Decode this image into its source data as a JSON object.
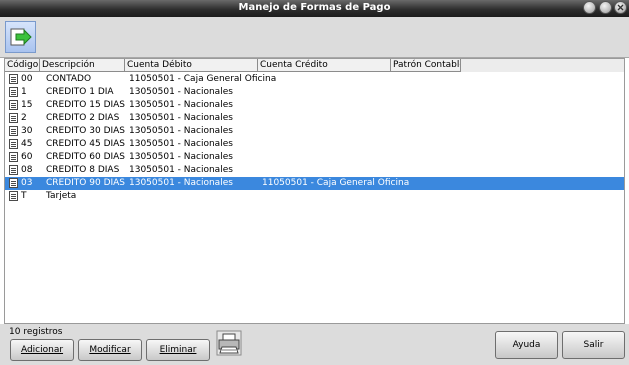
{
  "window": {
    "title": "Manejo de Formas de Pago"
  },
  "toolbar": {
    "next_icon": "arrow-right-icon"
  },
  "table": {
    "columns": [
      "Código",
      "Descripción",
      "Cuenta Débito",
      "Cuenta Crédito",
      "Patrón Contable"
    ],
    "rows": [
      {
        "codigo": "00",
        "descripcion": "CONTADO",
        "debito": "11050501 - Caja General Oficina",
        "credito": "",
        "patron": "",
        "selected": false
      },
      {
        "codigo": "1",
        "descripcion": "CREDITO 1 DIA",
        "debito": "13050501 - Nacionales",
        "credito": "",
        "patron": "",
        "selected": false
      },
      {
        "codigo": "15",
        "descripcion": "CREDITO 15 DIAS",
        "debito": "13050501 - Nacionales",
        "credito": "",
        "patron": "",
        "selected": false
      },
      {
        "codigo": "2",
        "descripcion": "CREDITO 2 DIAS",
        "debito": "13050501 - Nacionales",
        "credito": "",
        "patron": "",
        "selected": false
      },
      {
        "codigo": "30",
        "descripcion": "CREDITO 30 DIAS",
        "debito": "13050501 - Nacionales",
        "credito": "",
        "patron": "",
        "selected": false
      },
      {
        "codigo": "45",
        "descripcion": "CREDITO 45 DIAS",
        "debito": "13050501 - Nacionales",
        "credito": "",
        "patron": "",
        "selected": false
      },
      {
        "codigo": "60",
        "descripcion": "CREDITO 60 DIAS",
        "debito": "13050501 - Nacionales",
        "credito": "",
        "patron": "",
        "selected": false
      },
      {
        "codigo": "08",
        "descripcion": "CREDITO 8 DIAS",
        "debito": "13050501 - Nacionales",
        "credito": "",
        "patron": "",
        "selected": false
      },
      {
        "codigo": "03",
        "descripcion": "CREDITO 90 DIAS",
        "debito": "13050501 - Nacionales",
        "credito": "11050501 - Caja General Oficina",
        "patron": "",
        "selected": true
      },
      {
        "codigo": "T",
        "descripcion": "Tarjeta",
        "debito": "",
        "credito": "",
        "patron": "",
        "selected": false
      }
    ]
  },
  "footer": {
    "record_count": "10 registros",
    "buttons": {
      "adicionar": "Adicionar",
      "modificar": "Modificar",
      "eliminar": "Eliminar",
      "ayuda": "Ayuda",
      "salir": "Salir"
    }
  },
  "colors": {
    "selection": "#3b88de",
    "titlebar": "#2e2e2e"
  }
}
